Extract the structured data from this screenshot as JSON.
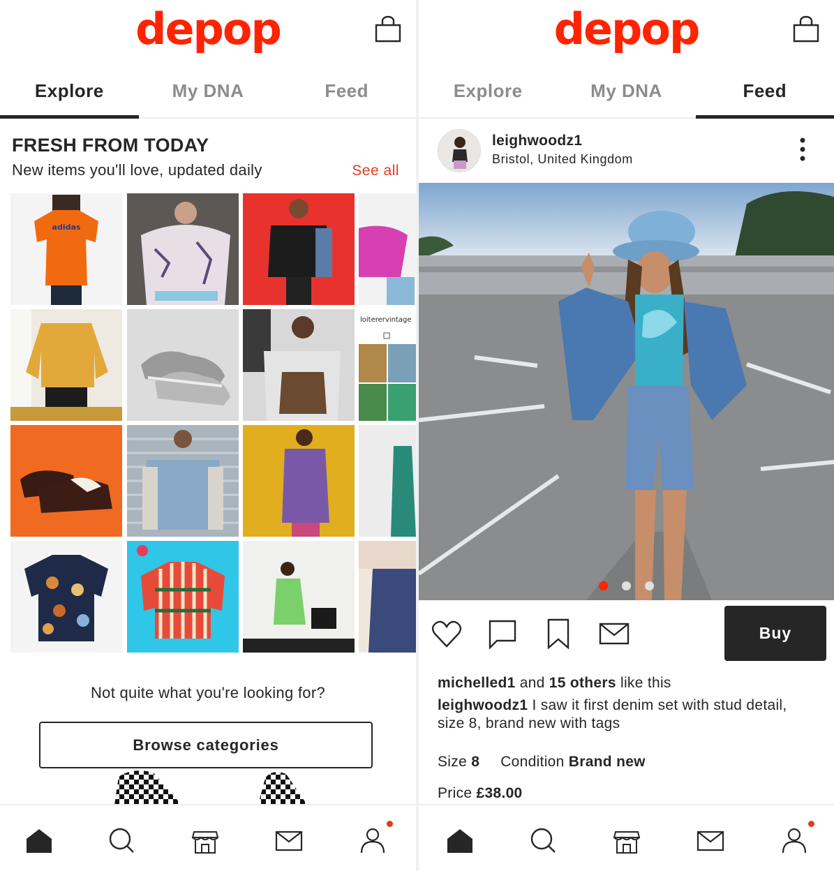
{
  "left": {
    "brand": "depop",
    "tabs": [
      "Explore",
      "My DNA",
      "Feed"
    ],
    "active_tab": "Explore",
    "section": {
      "title": "FRESH FROM TODAY",
      "subtitle": "New items you'll love, updated daily",
      "see_all": "See all"
    },
    "grid_labels": {
      "tee_brand": "adidas",
      "shop_name": "loiterervintage"
    },
    "not_quite": "Not quite what you're looking for?",
    "browse_label": "Browse categories"
  },
  "right": {
    "brand": "depop",
    "tabs": [
      "Explore",
      "My DNA",
      "Feed"
    ],
    "active_tab": "Feed",
    "post": {
      "username": "leighwoodz1",
      "location": "Bristol, United Kingdom",
      "carousel_count": 3,
      "carousel_active": 1,
      "buy_label": "Buy",
      "likes": {
        "user": "michelled1",
        "mid": " and ",
        "others": "15 others",
        "suffix": " like this"
      },
      "caption_user": "leighwoodz1",
      "caption_text": " I saw it first denim set with stud detail, size 8, brand new with tags",
      "size_label": "Size",
      "size_value": "8",
      "condition_label": "Condition",
      "condition_value": "Brand new",
      "price_label": "Price",
      "price_value": "£38.00"
    }
  },
  "nav": [
    "home-icon",
    "search-icon",
    "shop-icon",
    "messages-icon",
    "profile-icon"
  ],
  "colors": {
    "brand": "#ff2300",
    "accent_link": "#e6391b",
    "dark": "#262626",
    "inactive": "#8c8c8c"
  }
}
